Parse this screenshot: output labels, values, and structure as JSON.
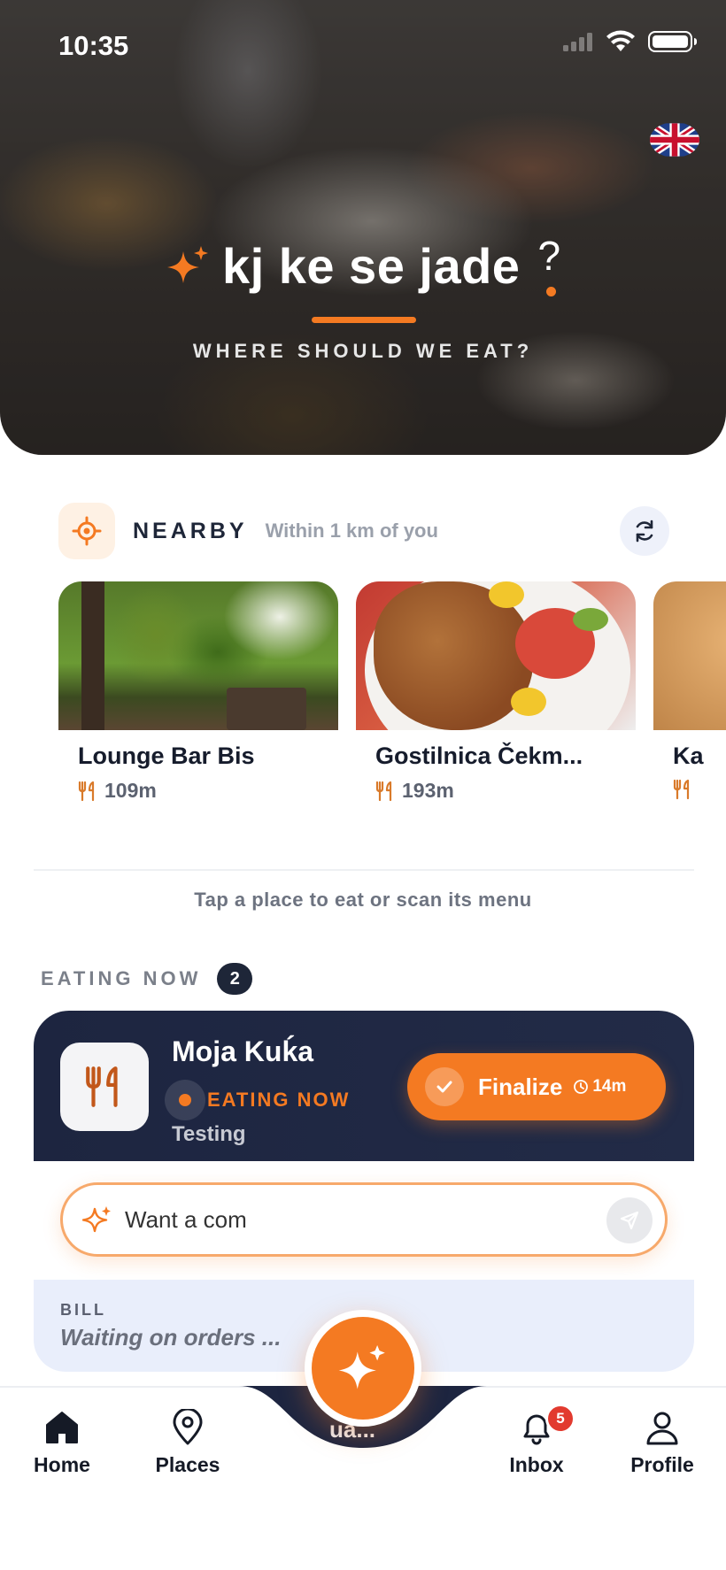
{
  "status_bar": {
    "time": "10:35"
  },
  "hero": {
    "title": "kj ke se jade",
    "question_mark": "?",
    "subtitle": "WHERE SHOULD WE EAT?",
    "language_flag": "uk-flag-icon"
  },
  "nearby": {
    "title": "NEARBY",
    "subtitle": "Within 1 km of you",
    "places": [
      {
        "name": "Lounge Bar Bis",
        "distance": "109m"
      },
      {
        "name": "Gostilnica Čekm...",
        "distance": "193m"
      },
      {
        "name": "Ka",
        "distance": ""
      }
    ],
    "hint": "Tap a place to eat or scan its menu"
  },
  "eating_now": {
    "title": "EATING NOW",
    "count": "2",
    "card": {
      "name": "Moja Kuḱa",
      "status": "EATING NOW",
      "note": "Testing",
      "finalize_label": "Finalize",
      "timer": "14m"
    },
    "prompt": {
      "value": "Want a com",
      "placeholder": "Want a com"
    },
    "bill": {
      "label": "BILL",
      "status": "Waiting on orders ..."
    },
    "partial_text": "ua..."
  },
  "tabbar": {
    "home": "Home",
    "places": "Places",
    "inbox": "Inbox",
    "inbox_badge": "5",
    "profile": "Profile"
  },
  "colors": {
    "accent": "#f47a22",
    "navy": "#1d2540",
    "badge_red": "#e23a2f"
  }
}
